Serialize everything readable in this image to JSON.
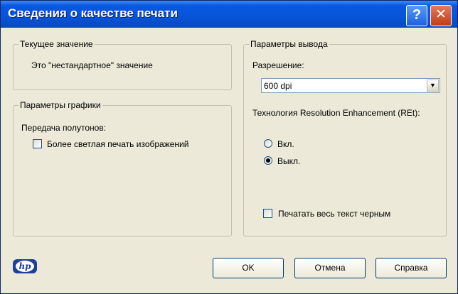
{
  "window": {
    "title": "Сведения о качестве печати"
  },
  "titlebar": {
    "help_glyph": "?",
    "close_glyph": "✕"
  },
  "current_value": {
    "legend": "Текущее значение",
    "text": "Это \"нестандартное\" значение"
  },
  "graphics": {
    "legend": "Параметры графики",
    "halftone_label": "Передача полутонов:",
    "lighter_print": {
      "label": "Более светлая печать изображений",
      "checked": false
    }
  },
  "output": {
    "legend": "Параметры вывода",
    "resolution_label": "Разрешение:",
    "resolution_value": "600 dpi",
    "ret_label": "Технология Resolution Enhancement (REt):",
    "ret_on": {
      "label": "Вкл.",
      "checked": false
    },
    "ret_off": {
      "label": "Выкл.",
      "checked": true
    },
    "print_black": {
      "label": "Печатать весь текст черным",
      "checked": false
    }
  },
  "buttons": {
    "ok": "OK",
    "cancel": "Отмена",
    "help": "Справка"
  },
  "logo": {
    "text": "hp",
    "icon": "hp-logo-icon"
  }
}
